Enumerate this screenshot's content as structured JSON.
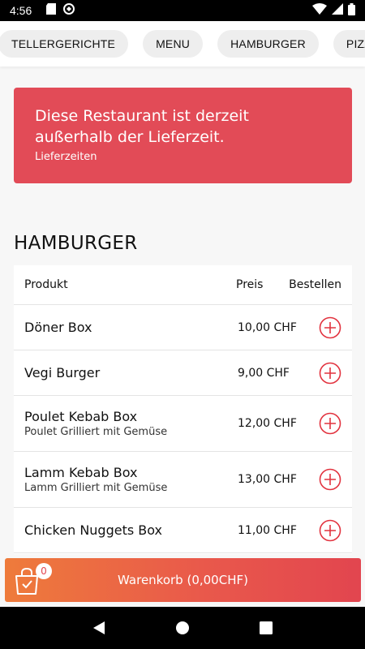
{
  "status_bar": {
    "time": "4:56",
    "icons": [
      "sd-card-icon",
      "sync-icon",
      "wifi-icon",
      "signal-icon",
      "battery-icon"
    ]
  },
  "categories": [
    {
      "label": "TELLERGERICHTE"
    },
    {
      "label": "MENU"
    },
    {
      "label": "HAMBURGER"
    },
    {
      "label": "PIZZA"
    }
  ],
  "alert": {
    "title": "Diese Restaurant ist derzeit außerhalb der Lieferzeit.",
    "link": "Lieferzeiten",
    "color": "#e24b57"
  },
  "section": {
    "title": "HAMBURGER"
  },
  "table": {
    "headers": {
      "product": "Produkt",
      "price": "Preis",
      "order": "Bestellen"
    },
    "items": [
      {
        "name": "Döner Box",
        "description": "",
        "price": "10,00 CHF"
      },
      {
        "name": "Vegi Burger",
        "description": "",
        "price": "9,00 CHF"
      },
      {
        "name": "Poulet Kebab Box",
        "description": "Poulet Grilliert mit Gemüse",
        "price": "12,00 CHF"
      },
      {
        "name": "Lamm Kebab Box",
        "description": "Lamm Grilliert mit Gemüse",
        "price": "13,00 CHF"
      },
      {
        "name": "Chicken Nuggets Box",
        "description": "",
        "price": "11,00 CHF"
      }
    ],
    "add_icon_color": "#e2333f"
  },
  "cart": {
    "label": "Warenkorb (0,00CHF)",
    "count": "0",
    "icon": "shopping-bag-icon"
  },
  "nav": {
    "icons": [
      "back-icon",
      "home-icon",
      "recents-icon"
    ]
  }
}
